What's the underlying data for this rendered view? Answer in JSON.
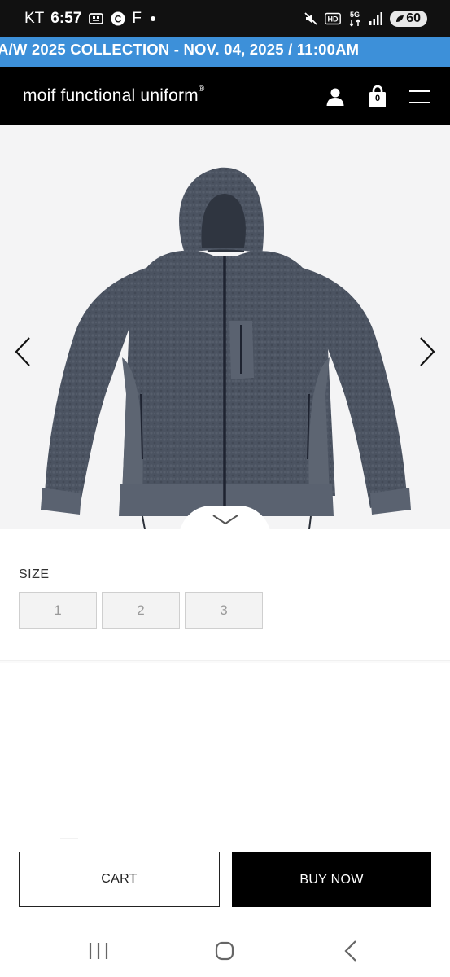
{
  "status_bar": {
    "carrier": "KT",
    "time": "6:57",
    "left_letter": "F",
    "network": "5G",
    "hd": "HD",
    "battery": "60",
    "icons": [
      "screen-capture-icon",
      "c-badge-icon",
      "dot-icon",
      "mute-icon",
      "hd-icon",
      "network-5g-icon",
      "signal-icon",
      "battery-icon"
    ]
  },
  "announcement": {
    "text": "A/W 2025 COLLECTION - NOV. 04, 2025 / 11:00AM"
  },
  "header": {
    "brand": "moif functional uniform",
    "brand_mark": "®",
    "cart_count": "0",
    "icons": [
      "user-icon",
      "shopping-bag-icon",
      "hamburger-menu-icon"
    ]
  },
  "gallery": {
    "image": "gray-fleece-hooded-jacket",
    "icons": [
      "chevron-left-icon",
      "chevron-right-icon",
      "chevron-down-icon"
    ]
  },
  "options": {
    "size_label": "SIZE",
    "sizes": [
      "1",
      "2",
      "3"
    ]
  },
  "actions": {
    "cart_label": "CART",
    "buy_label": "BUY NOW"
  },
  "nav_bar": {
    "icons": [
      "recent-apps-icon",
      "home-icon",
      "back-icon"
    ]
  },
  "colors": {
    "banner": "#3d90d9",
    "header": "#000000",
    "gallery_bg": "#f4f4f5",
    "jacket": "#4a5260"
  }
}
